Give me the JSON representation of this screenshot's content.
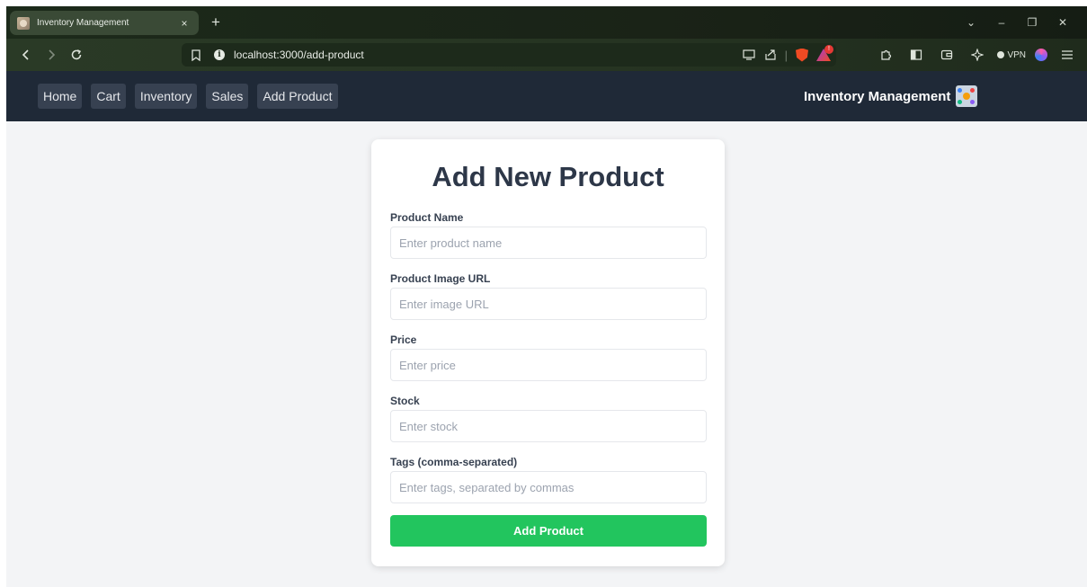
{
  "browser": {
    "tab": {
      "title": "Inventory Management",
      "close_glyph": "×"
    },
    "new_tab_glyph": "+",
    "window_controls": {
      "dropdown": "⌄",
      "minimize": "–",
      "restore": "❐",
      "close": "✕"
    },
    "url": "localhost:3000/add-product",
    "vpn_label": "VPN",
    "rewards_badge": "!"
  },
  "nav": {
    "links": [
      {
        "label": "Home"
      },
      {
        "label": "Cart"
      },
      {
        "label": "Inventory"
      },
      {
        "label": "Sales"
      },
      {
        "label": "Add Product"
      }
    ],
    "brand": "Inventory Management"
  },
  "form": {
    "title": "Add New Product",
    "fields": [
      {
        "label": "Product Name",
        "placeholder": "Enter product name",
        "value": ""
      },
      {
        "label": "Product Image URL",
        "placeholder": "Enter image URL",
        "value": ""
      },
      {
        "label": "Price",
        "placeholder": "Enter price",
        "value": ""
      },
      {
        "label": "Stock",
        "placeholder": "Enter stock",
        "value": ""
      },
      {
        "label": "Tags (comma-separated)",
        "placeholder": "Enter tags, separated by commas",
        "value": ""
      }
    ],
    "submit_label": "Add Product"
  },
  "colors": {
    "navbar_bg": "#1f2937",
    "nav_link_bg": "#374151",
    "submit_bg": "#22c55e",
    "page_bg": "#f3f4f6",
    "title_color": "#2d3748"
  }
}
